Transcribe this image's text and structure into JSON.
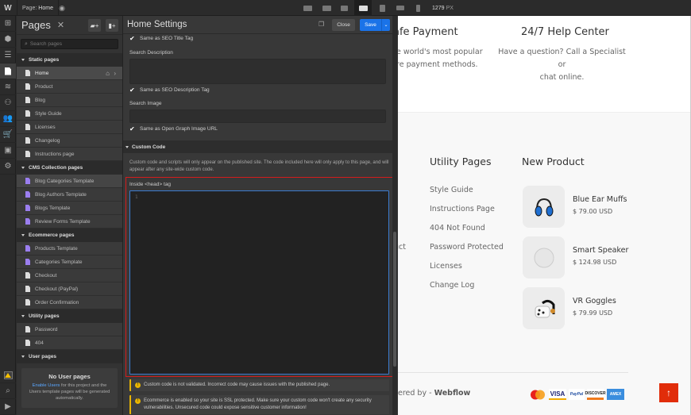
{
  "topbar": {
    "logo": "W",
    "page_prefix": "Page:",
    "page_name": "Home",
    "preview_icon": "eye-icon",
    "breakpoints": [
      "desktop-xl-icon",
      "desktop-l-icon",
      "desktop-m-icon",
      "desktop-base-icon",
      "tablet-icon",
      "mobile-landscape-icon",
      "mobile-portrait-icon"
    ],
    "active_breakpoint": "desktop-base-icon",
    "width_value": "1279",
    "width_unit": "PX"
  },
  "rail": {
    "items": [
      "add-icon",
      "cube-icon",
      "navigator-icon",
      "pages-icon",
      "cms-icon",
      "users-icon",
      "team-icon",
      "ecommerce-icon",
      "assets-icon",
      "settings-icon"
    ],
    "active": "pages-icon",
    "bottom": [
      "warning-icon",
      "search-icon",
      "video-icon"
    ]
  },
  "pages_panel": {
    "title": "Pages",
    "close": "✕",
    "search_placeholder": "Search pages",
    "sections": [
      {
        "label": "Static pages",
        "items": [
          {
            "label": "Home",
            "type": "static",
            "selected": true
          },
          {
            "label": "Product",
            "type": "static"
          },
          {
            "label": "Blog",
            "type": "static"
          },
          {
            "label": "Style Guide",
            "type": "static"
          },
          {
            "label": "Licenses",
            "type": "static"
          },
          {
            "label": "Changelog",
            "type": "static"
          },
          {
            "label": "Instructions page",
            "type": "static"
          }
        ]
      },
      {
        "label": "CMS Collection pages",
        "items": [
          {
            "label": "Blog Categories Template",
            "type": "cms",
            "hover": true
          },
          {
            "label": "Blog Authors Template",
            "type": "cms"
          },
          {
            "label": "Blogs Template",
            "type": "cms"
          },
          {
            "label": "Review Forms Template",
            "type": "cms"
          }
        ]
      },
      {
        "label": "Ecommerce pages",
        "items": [
          {
            "label": "Products Template",
            "type": "cms"
          },
          {
            "label": "Categories Template",
            "type": "cms"
          },
          {
            "label": "Checkout",
            "type": "static"
          },
          {
            "label": "Checkout (PayPal)",
            "type": "static"
          },
          {
            "label": "Order Confirmation",
            "type": "static"
          }
        ]
      },
      {
        "label": "Utility pages",
        "items": [
          {
            "label": "Password",
            "type": "static"
          },
          {
            "label": "404",
            "type": "static"
          }
        ]
      },
      {
        "label": "User pages",
        "items": []
      }
    ],
    "no_user": {
      "title": "No User pages",
      "link": "Enable Users",
      "text": " for this project and the Users template pages will be generated automatically."
    }
  },
  "settings": {
    "title": "Home Settings",
    "close_label": "Close",
    "save_label": "Save",
    "check_seo_title": "Same as SEO Title Tag",
    "search_description_label": "Search Description",
    "search_description_value": "",
    "check_seo_desc": "Same as SEO Description Tag",
    "search_image_label": "Search Image",
    "search_image_value": "",
    "check_og_image": "Same as Open Graph Image URL",
    "custom_code_label": "Custom Code",
    "custom_code_desc": "Custom code and scripts will only appear on the published site. The code included here will only apply to this page, and will appear after any site-wide custom code.",
    "head_label": "Inside <head> tag",
    "head_line_number": "1",
    "head_code": "",
    "warning_1": "Custom code is not validated. Incorrect code may cause issues with the published page.",
    "warning_2": "Ecommerce is enabled so your site is SSL protected. Make sure your custom code won't create any security vulnerabilities. Unsecured code could expose sensitive customer information!"
  },
  "canvas": {
    "features": [
      {
        "title": "afe Payment",
        "desc_1": "he world's most popular",
        "desc_2": "ure payment methods."
      },
      {
        "title": "24/7 Help Center",
        "desc_1": "Have a question? Call a Specialist or",
        "desc_2": "chat online."
      }
    ],
    "partial_link": "uct",
    "utility_title": "Utility Pages",
    "utility_links": [
      "Style Guide",
      "Instructions Page",
      "404 Not Found",
      "Password Protected",
      "Licenses",
      "Change Log"
    ],
    "new_product_title": "New Product",
    "products": [
      {
        "name": "Blue Ear Muffs",
        "price": "$ 79.00 USD",
        "icon": "headphones-icon"
      },
      {
        "name": "Smart Speaker",
        "price": "$ 124.98 USD",
        "icon": "speaker-icon"
      },
      {
        "name": "VR Goggles",
        "price": "$ 79.99 USD",
        "icon": "vr-goggles-icon"
      }
    ],
    "powered_prefix": "ered by - ",
    "powered_brand": "Webflow",
    "payment_methods": [
      "Mastercard",
      "VISA",
      "PayPal",
      "DISCOVER",
      "AMEX"
    ],
    "back_to_top": "↑",
    "colors": {
      "accent_blue": "#1a73e8",
      "highlight_red": "#d41c1c",
      "cms_purple": "#9b7ef0",
      "warning_yellow": "#e8b400",
      "back_to_top": "#e12d0a"
    }
  }
}
